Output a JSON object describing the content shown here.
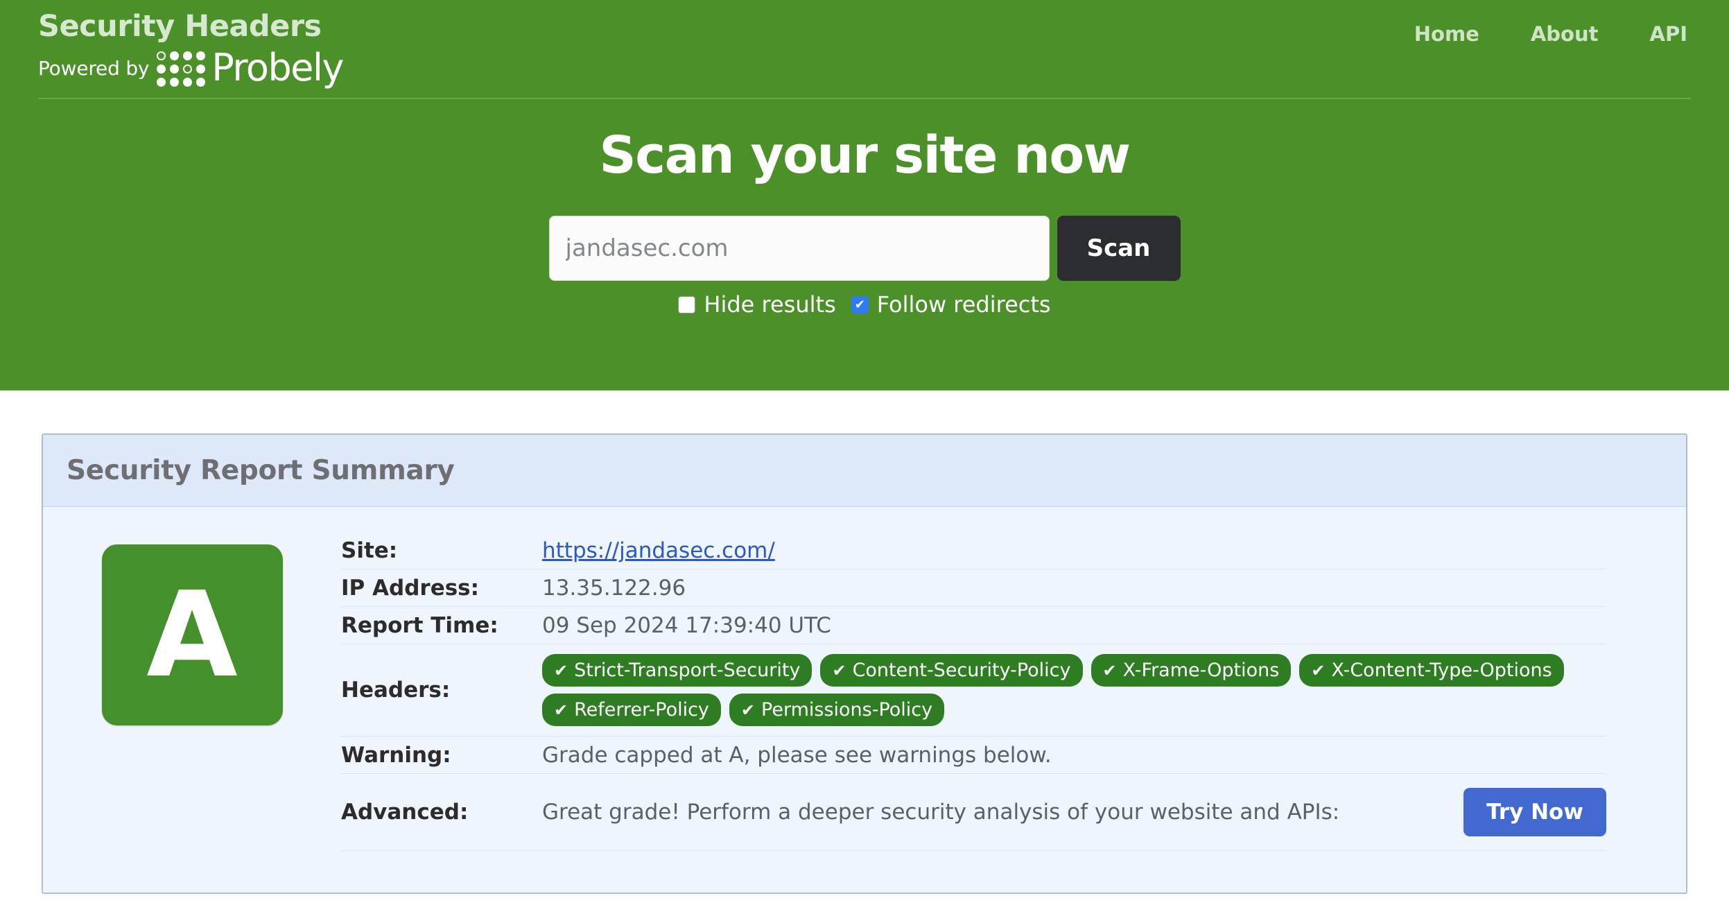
{
  "header": {
    "brand_title": "Security Headers",
    "powered_by": "Powered by",
    "brand_partner": "Probely",
    "nav": [
      {
        "label": "Home"
      },
      {
        "label": "About"
      },
      {
        "label": "API"
      }
    ],
    "heading": "Scan your site now",
    "colors": {
      "hero_green": "#4c9029",
      "nav_link": "#cfe4c6",
      "scan_button_bg": "#2b2d31"
    }
  },
  "scan_form": {
    "input_value": "jandasec.com",
    "input_placeholder": "jandasec.com",
    "submit_label": "Scan",
    "options": [
      {
        "label": "Hide results",
        "checked": false
      },
      {
        "label": "Follow redirects",
        "checked": true
      }
    ],
    "checked_color": "#2f7bf6"
  },
  "report": {
    "card_title": "Security Report Summary",
    "grade": "A",
    "grade_color": "#44902a",
    "rows": {
      "site_label": "Site:",
      "site_value": "https://jandasec.com/",
      "ip_label": "IP Address:",
      "ip_value": "13.35.122.96",
      "time_label": "Report Time:",
      "time_value": "09 Sep 2024 17:39:40 UTC",
      "headers_label": "Headers:",
      "warning_label": "Warning:",
      "warning_value": "Grade capped at A, please see warnings below.",
      "advanced_label": "Advanced:",
      "advanced_value": "Great grade! Perform a deeper security analysis of your website and APIs:",
      "advanced_button": "Try Now"
    },
    "headers_badges": [
      {
        "tick": "✔",
        "label": "Strict-Transport-Security"
      },
      {
        "tick": "✔",
        "label": "Content-Security-Policy"
      },
      {
        "tick": "✔",
        "label": "X-Frame-Options"
      },
      {
        "tick": "✔",
        "label": "X-Content-Type-Options"
      },
      {
        "tick": "✔",
        "label": "Referrer-Policy"
      },
      {
        "tick": "✔",
        "label": "Permissions-Policy"
      }
    ],
    "badge_color": "#2e7d22",
    "try_now_color": "#4169d0"
  }
}
